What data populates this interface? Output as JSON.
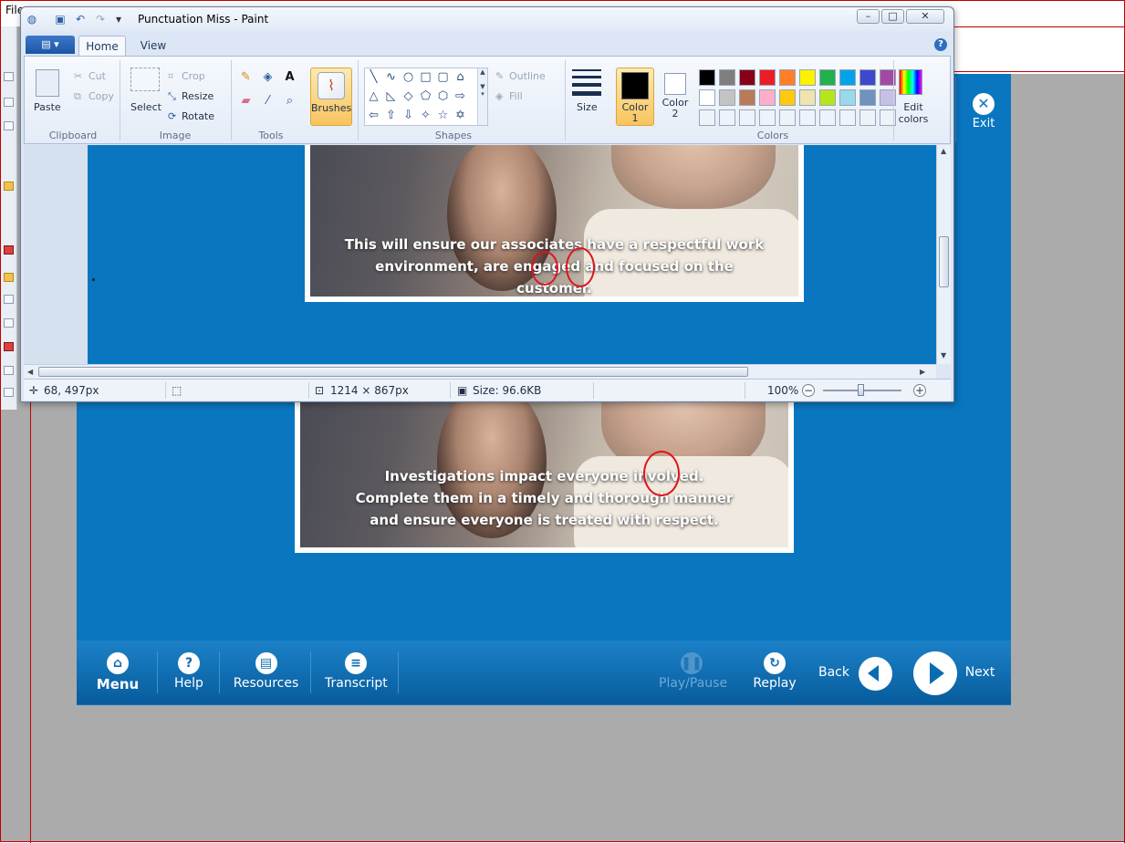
{
  "host": {
    "menu_text": "File"
  },
  "course": {
    "exit_label": "Exit",
    "caption_upper": "This will ensure our associates have a respectful work environment, are engaged and focused on the customer.",
    "caption_lower": "Investigations impact everyone involved. Complete them in a timely and thorough manner and ensure everyone is treated with respect.",
    "nav": {
      "menu": "Menu",
      "help": "Help",
      "resources": "Resources",
      "transcript": "Transcript",
      "play_pause": "Play/Pause",
      "replay": "Replay",
      "back": "Back",
      "next": "Next"
    }
  },
  "paint": {
    "title": "Punctuation Miss - Paint",
    "tabs": [
      "Home",
      "View"
    ],
    "clipboard": {
      "paste": "Paste",
      "cut": "Cut",
      "copy": "Copy",
      "label": "Clipboard"
    },
    "image": {
      "select": "Select",
      "crop": "Crop",
      "resize": "Resize",
      "rotate": "Rotate",
      "label": "Image"
    },
    "tools": {
      "label": "Tools"
    },
    "brushes": "Brushes",
    "shapes": {
      "outline": "Outline",
      "fill": "Fill",
      "label": "Shapes"
    },
    "size": "Size",
    "color1": "Color 1",
    "color2": "Color 2",
    "colors_label": "Colors",
    "edit_colors": "Edit colors",
    "palette_row1": [
      "#000000",
      "#7f7f7f",
      "#880015",
      "#ed1c24",
      "#ff7f27",
      "#fff200",
      "#22b14c",
      "#00a2e8",
      "#3f48cc",
      "#a349a4"
    ],
    "palette_row2": [
      "#ffffff",
      "#c3c3c3",
      "#b97a57",
      "#ffaec9",
      "#ffc90e",
      "#efe4b0",
      "#b5e61d",
      "#99d9ea",
      "#7092be",
      "#c8bfe7"
    ],
    "status": {
      "cursor": "68, 497px",
      "dimensions": "1214 × 867px",
      "size": "Size: 96.6KB",
      "zoom": "100%"
    }
  }
}
